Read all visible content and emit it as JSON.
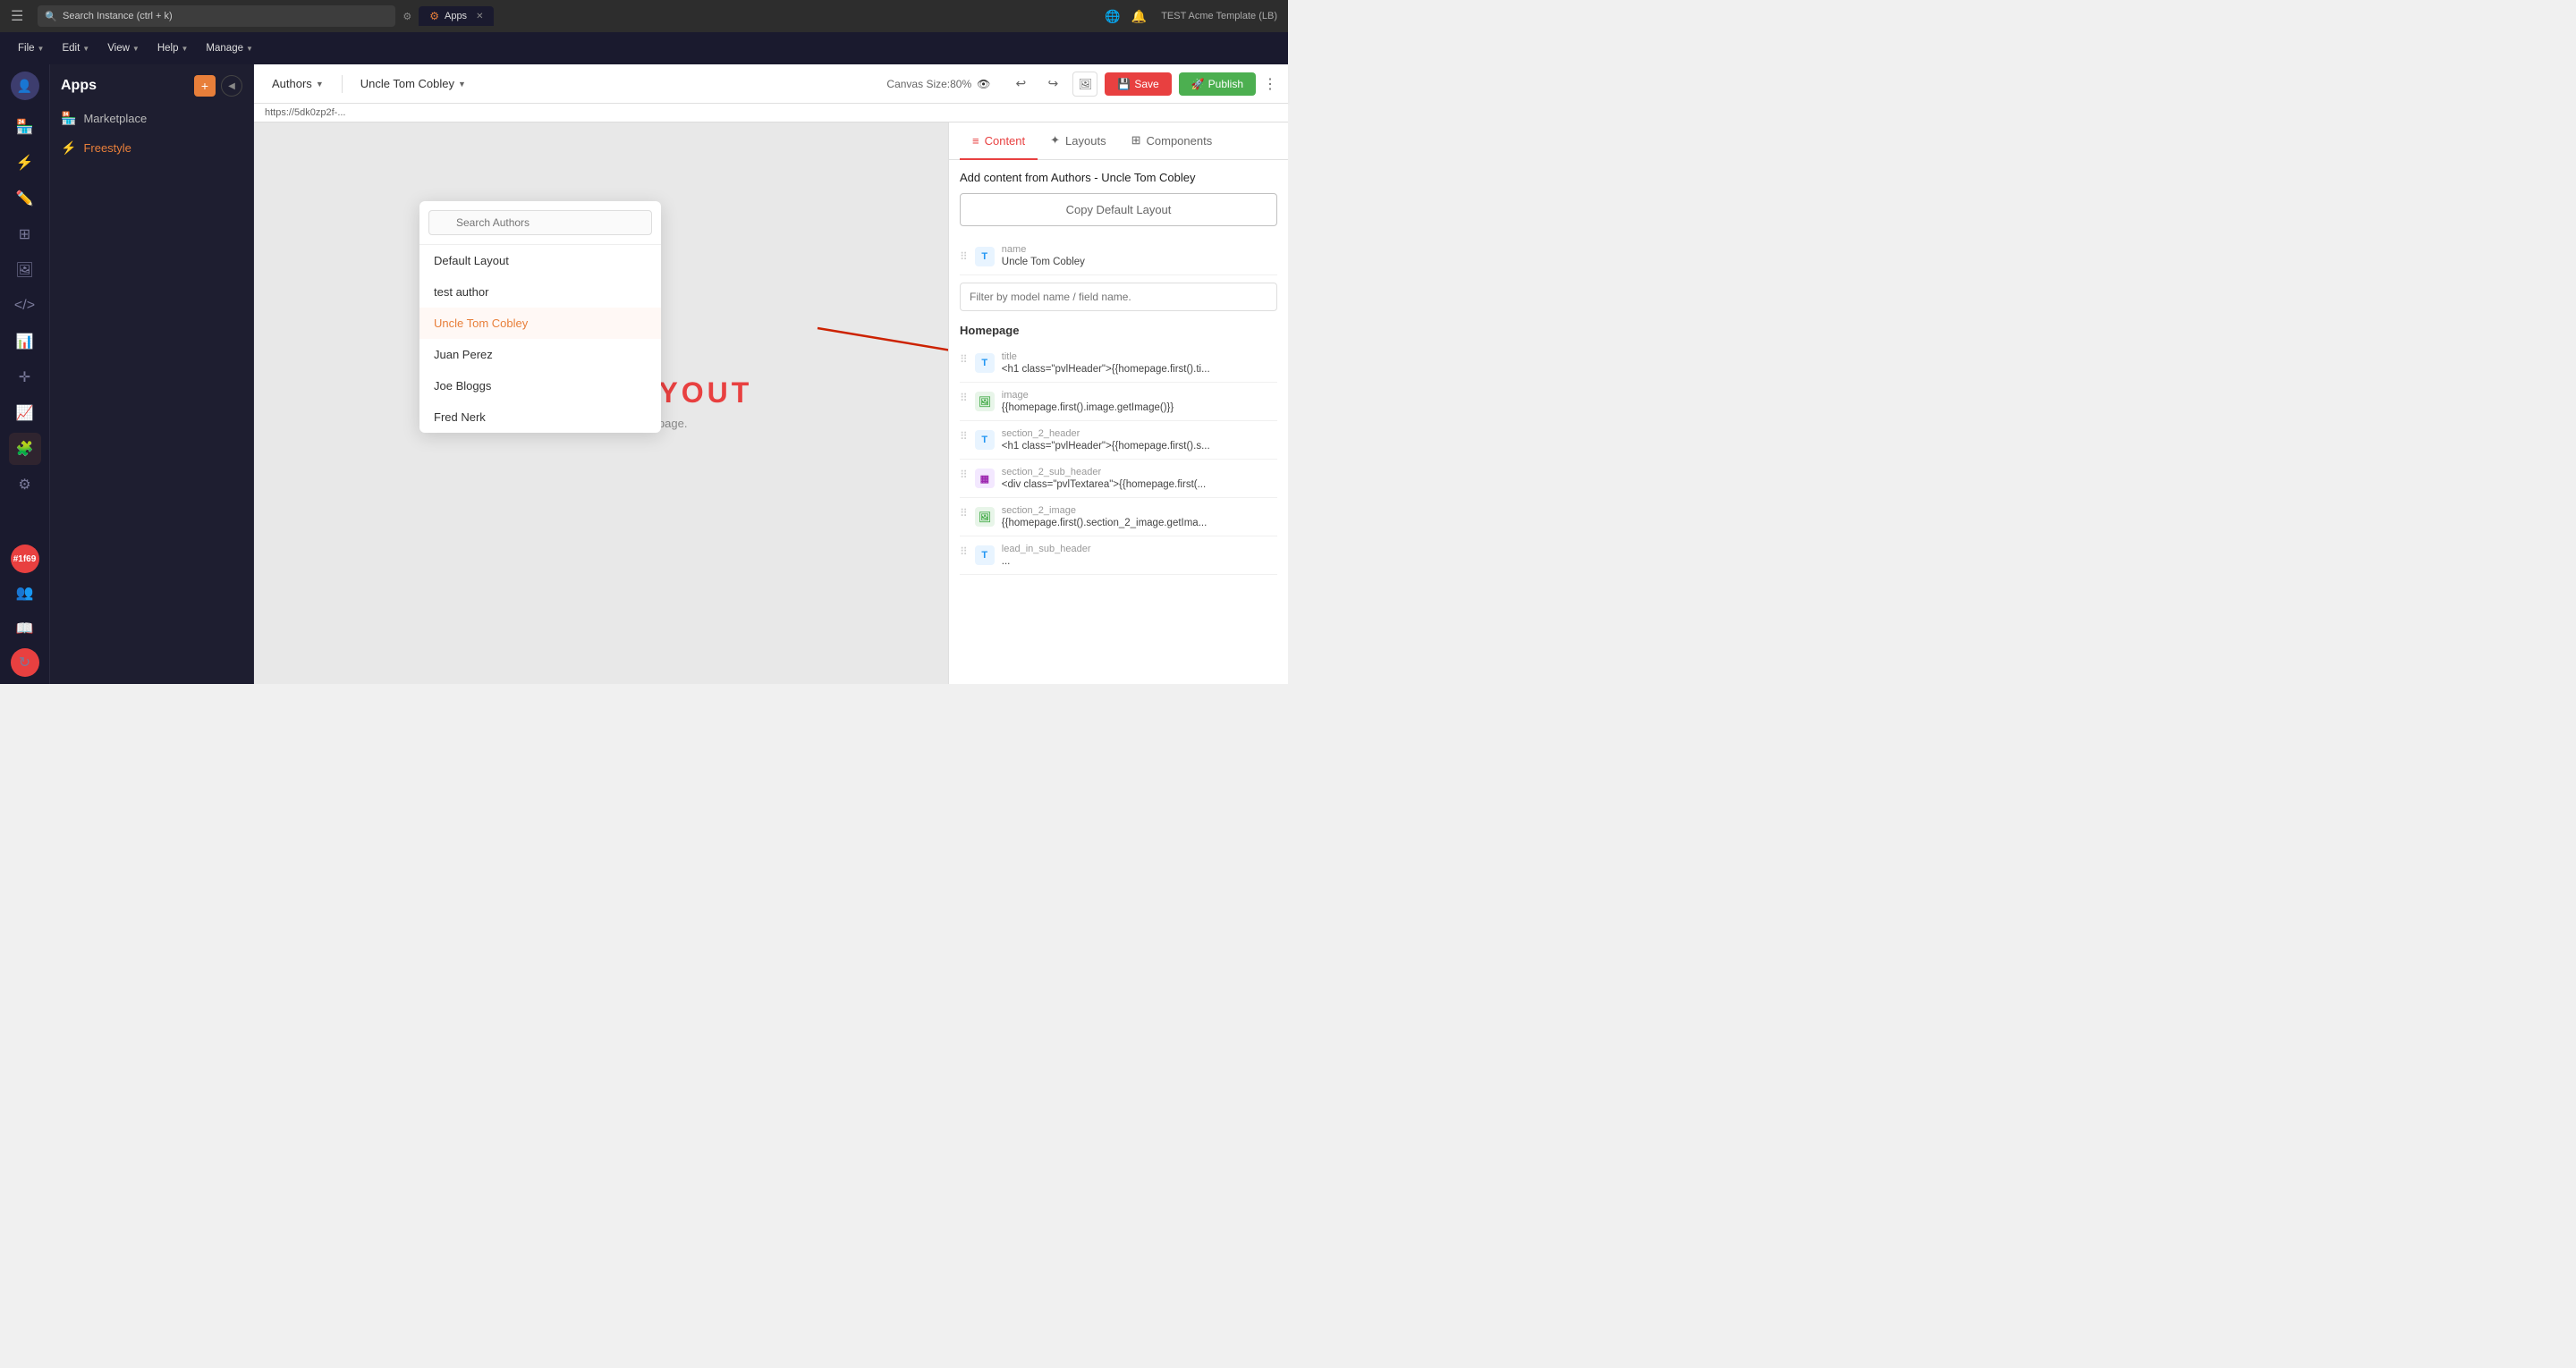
{
  "browser": {
    "search_placeholder": "Search Instance (ctrl + k)",
    "tab_label": "Apps",
    "tab_icon": "⚙",
    "instance_label": "TEST Acme Template (LB)"
  },
  "toolbar": {
    "file_label": "File",
    "edit_label": "Edit",
    "view_label": "View",
    "help_label": "Help",
    "manage_label": "Manage"
  },
  "apps_panel": {
    "title": "Apps",
    "marketplace_label": "Marketplace",
    "freestyle_label": "Freestyle"
  },
  "editor": {
    "authors_label": "Authors",
    "author_selected": "Uncle Tom Cobley",
    "canvas_size": "Canvas Size:80%",
    "save_label": "Save",
    "publish_label": "Publish",
    "url_bar": "https://5dk0zp2f-..."
  },
  "authors_dropdown": {
    "search_placeholder": "Search Authors",
    "items": [
      {
        "label": "Default Layout",
        "selected": false
      },
      {
        "label": "test author",
        "selected": false
      },
      {
        "label": "Uncle Tom Cobley",
        "selected": true
      },
      {
        "label": "Juan Perez",
        "selected": false
      },
      {
        "label": "Joe Bloggs",
        "selected": false
      },
      {
        "label": "Fred Nerk",
        "selected": false
      }
    ]
  },
  "canvas": {
    "layout_text": "DEFAULT LAYOUT",
    "sub_text": "right to start designing your page.",
    "layout_display": "AYOUT"
  },
  "right_panel": {
    "tabs": [
      {
        "label": "Content",
        "icon": "≡",
        "active": true
      },
      {
        "label": "Layouts",
        "icon": "✦",
        "active": false
      },
      {
        "label": "Components",
        "icon": "⊞",
        "active": false
      }
    ],
    "add_content_title": "Add content from Authors - Uncle Tom Cobley",
    "copy_default_btn": "Copy Default Layout",
    "filter_placeholder": "Filter by model name / field name.",
    "name_section": {
      "label": "name",
      "value": "Uncle Tom Cobley"
    },
    "homepage_title": "Homepage",
    "items": [
      {
        "type": "text",
        "label": "title",
        "value": "<h1 class=\"pvlHeader\">{{homepage.first().ti..."
      },
      {
        "type": "image",
        "label": "image",
        "value": "{{homepage.first().image.getImage()}}"
      },
      {
        "type": "text",
        "label": "section_2_header",
        "value": "<h1 class=\"pvlHeader\">{{homepage.first().s..."
      },
      {
        "type": "div",
        "label": "section_2_sub_header",
        "value": "<div class=\"pvlTextarea\">{{homepage.first(..."
      },
      {
        "type": "image",
        "label": "section_2_image",
        "value": "{{homepage.first().section_2_image.getIma..."
      },
      {
        "type": "text",
        "label": "lead_in_sub_header",
        "value": "..."
      }
    ]
  }
}
